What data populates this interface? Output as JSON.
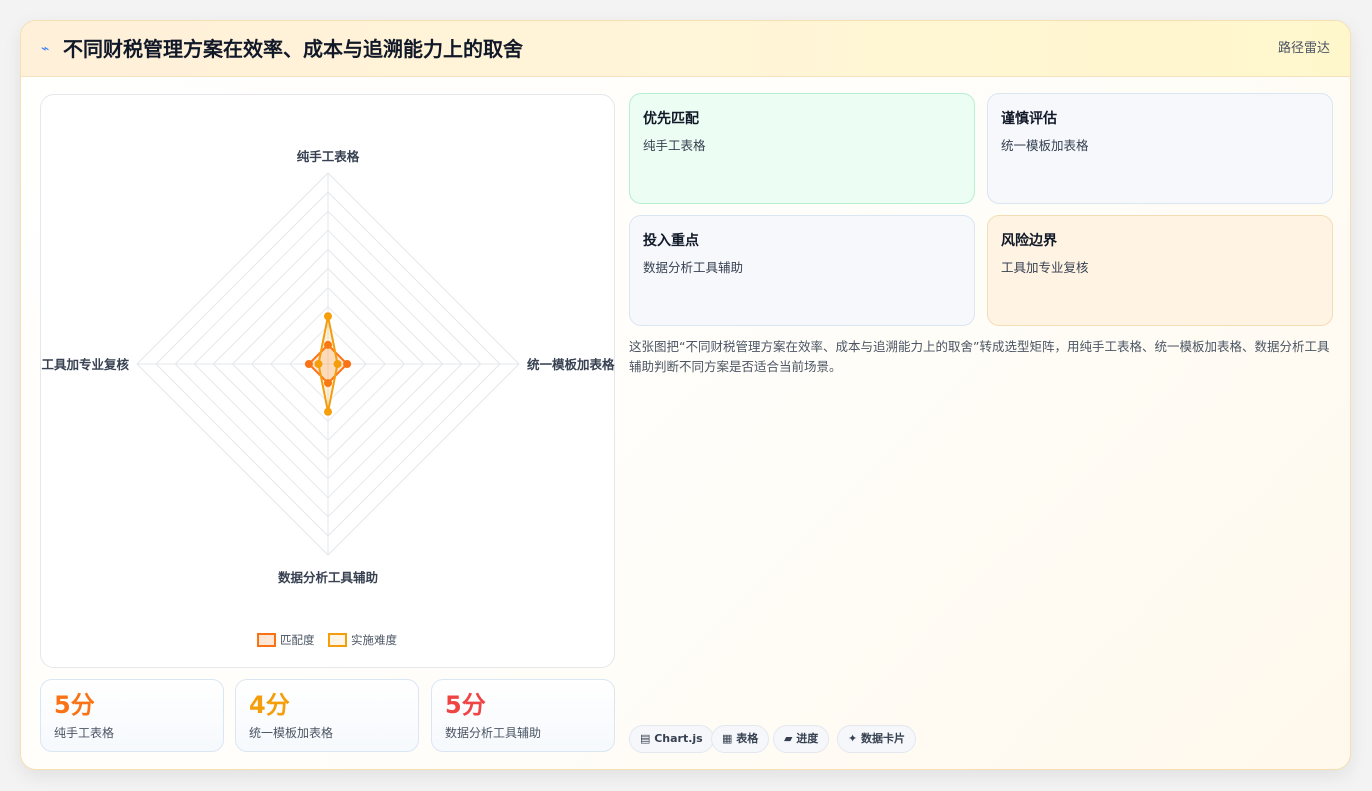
{
  "header": {
    "icon": "trend-icon",
    "title": "不同财税管理方案在效率、成本与追溯能力上的取舍",
    "tag": "路径雷达"
  },
  "chart_data": {
    "type": "radar",
    "axes": [
      "纯手工表格",
      "统一模板加表格",
      "数据分析工具辅助",
      "工具加专业复核"
    ],
    "r_range": [
      0,
      20
    ],
    "grid": true,
    "legend_position": "bottom",
    "series": [
      {
        "name": "匹配度",
        "values": [
          2,
          2,
          2,
          2
        ],
        "color": "#f97316"
      },
      {
        "name": "实施难度",
        "values": [
          5,
          1,
          5,
          1
        ],
        "color": "#f59e0b"
      }
    ]
  },
  "stats": [
    {
      "value": "5分",
      "label": "纯手工表格",
      "color": "#f97316"
    },
    {
      "value": "4分",
      "label": "统一模板加表格",
      "color": "#f59e0b"
    },
    {
      "value": "5分",
      "label": "数据分析工具辅助",
      "color": "#ef4444"
    }
  ],
  "tiles": [
    {
      "title": "优先匹配",
      "value": "纯手工表格"
    },
    {
      "title": "谨慎评估",
      "value": "统一模板加表格"
    },
    {
      "title": "投入重点",
      "value": "数据分析工具辅助"
    },
    {
      "title": "风险边界",
      "value": "工具加专业复核"
    }
  ],
  "description": "这张图把“不同财税管理方案在效率、成本与追溯能力上的取舍”转成选型矩阵，用纯手工表格、统一模板加表格、数据分析工具辅助判断不同方案是否适合当前场景。",
  "chips": [
    "▤ Chart.js",
    "▦ 表格",
    "▰ 进度",
    "✦ 数据卡片"
  ]
}
